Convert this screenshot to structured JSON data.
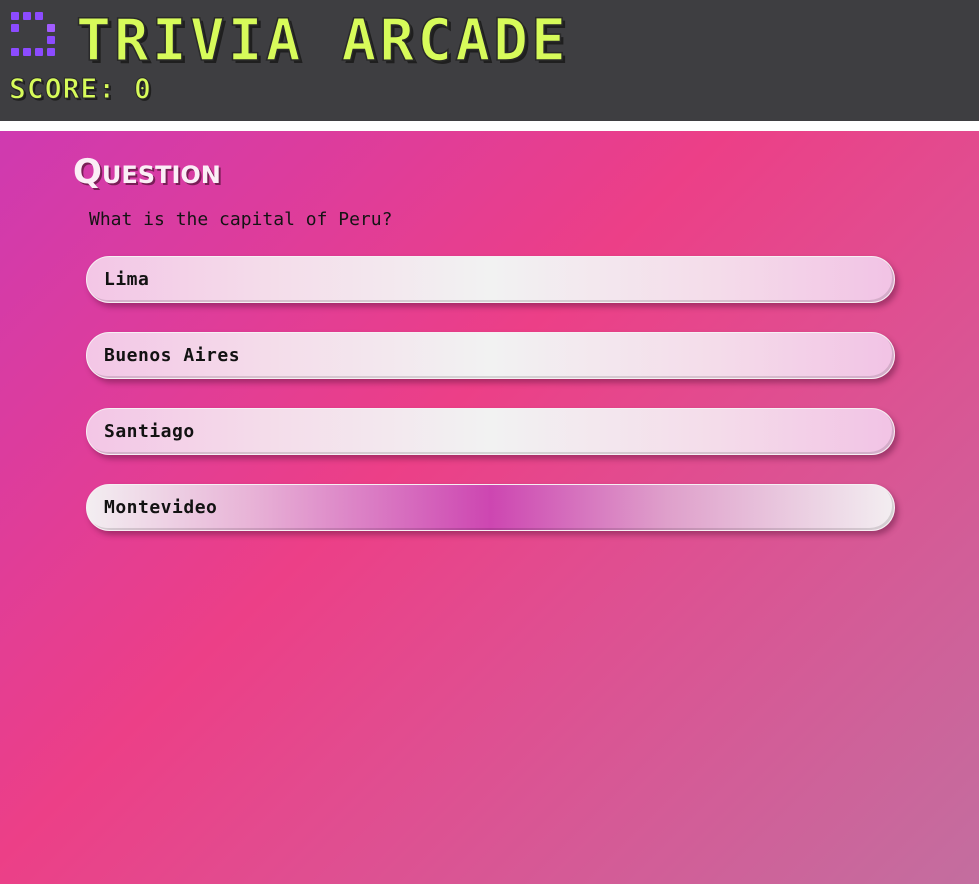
{
  "header": {
    "title": "Trivia Arcade",
    "score_text": "Score: 0",
    "logo_icon": "pixel-grid-icon",
    "title_color": "#d7fb5a",
    "logo_color": "#8c4bff",
    "background_color": "#3e3e41"
  },
  "main": {
    "heading": "Question",
    "question": "What is the capital of Peru?",
    "answers": [
      {
        "label": "Lima"
      },
      {
        "label": "Buenos Aires"
      },
      {
        "label": "Santiago"
      },
      {
        "label": "Montevideo"
      }
    ],
    "background_colors": [
      "#cf3ab0",
      "#ec3f87",
      "#c36e9f"
    ]
  }
}
